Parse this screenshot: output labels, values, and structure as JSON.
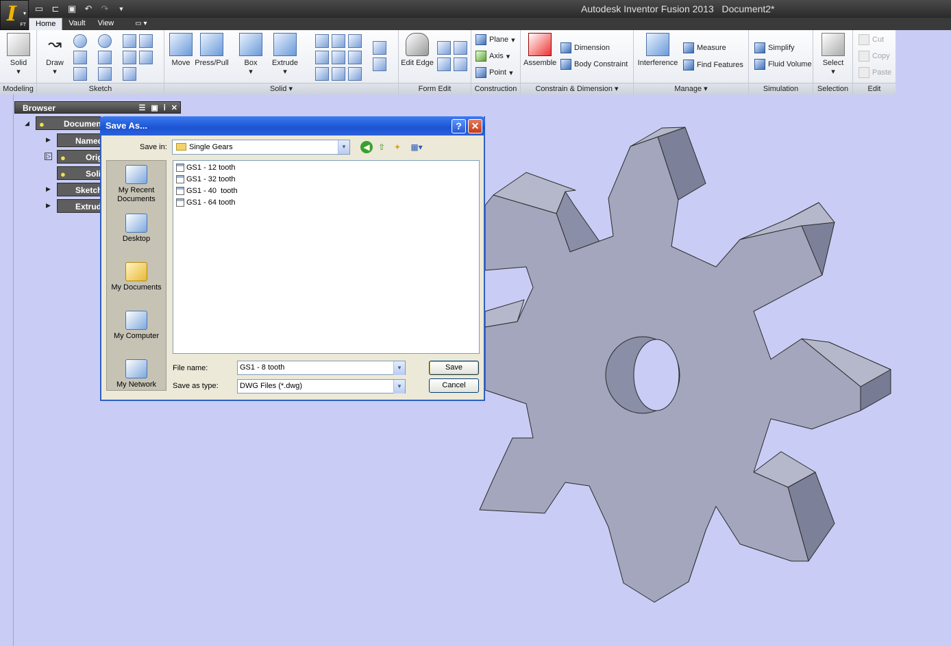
{
  "window": {
    "app_title": "Autodesk Inventor Fusion 2013",
    "document": "Document2*"
  },
  "appmenu": {
    "logo": "I",
    "badge": "FT"
  },
  "tabs": [
    "Home",
    "Vault",
    "View"
  ],
  "ribbon": {
    "panels": {
      "modeling": "Modeling",
      "sketch": "Sketch",
      "solid": "Solid",
      "form_edit": "Form Edit",
      "construction": "Construction",
      "constrain": "Constrain & Dimension",
      "manage": "Manage",
      "simulation": "Simulation",
      "selection": "Selection",
      "edit": "Edit"
    },
    "solid_btn": "Solid",
    "draw": "Draw",
    "move": "Move",
    "presspull": "Press/Pull",
    "box": "Box",
    "extrude": "Extrude",
    "edit_edge": "Edit Edge",
    "plane": "Plane",
    "axis": "Axis",
    "point": "Point",
    "assemble": "Assemble",
    "dimension": "Dimension",
    "body_constraint": "Body Constraint",
    "interference": "Interference",
    "measure": "Measure",
    "find_features": "Find Features",
    "simplify": "Simplify",
    "fluid_volume": "Fluid Volume",
    "select": "Select",
    "cut": "Cut",
    "copy": "Copy",
    "paste": "Paste"
  },
  "browser": {
    "title": "Browser",
    "items": [
      "Document",
      "Named",
      "Origi",
      "Solid",
      "Sketche",
      "Extrude"
    ]
  },
  "dialog": {
    "title": "Save As...",
    "save_in_label": "Save in:",
    "save_in_value": "Single Gears",
    "places": [
      {
        "label": "My Recent Documents"
      },
      {
        "label": "Desktop"
      },
      {
        "label": "My Documents"
      },
      {
        "label": "My Computer"
      },
      {
        "label": "My Network"
      }
    ],
    "files": [
      "GS1 - 12 tooth",
      "GS1 - 32 tooth",
      "GS1 - 40  tooth",
      "GS1 - 64 tooth"
    ],
    "file_name_label": "File name:",
    "file_name_value": "GS1 - 8 tooth",
    "save_type_label": "Save as type:",
    "save_type_value": "DWG Files (*.dwg)",
    "save_button": "Save",
    "cancel_button": "Cancel"
  },
  "colors": {
    "viewport_bg": "#c9cdf5",
    "gear_face": "#a3a6bd",
    "gear_side": "#7a7e96",
    "dialog_title": "#2b61d9"
  }
}
